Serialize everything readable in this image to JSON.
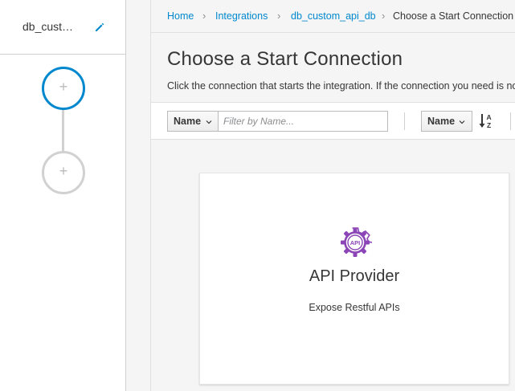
{
  "sidebar": {
    "integration_name": "db_custom_api_db",
    "icons": {
      "edit": "pencil-icon",
      "add_step": "plus-icon"
    },
    "steps": [
      {
        "state": "active",
        "glyph": "+"
      },
      {
        "state": "inactive",
        "glyph": "+"
      }
    ]
  },
  "breadcrumb": {
    "items": [
      "Home",
      "Integrations",
      "db_custom_api_db",
      "Choose a Start Connection"
    ],
    "separator": "›"
  },
  "page": {
    "title": "Choose a Start Connection",
    "description": "Click the connection that starts the integration. If the connection you need is not available, click Create Connection."
  },
  "toolbar": {
    "filter_type": "Name",
    "filter_placeholder": "Filter by Name...",
    "filter_value": "",
    "sort_field": "Name",
    "sort_direction_icon": "sort-alpha-ascending-icon"
  },
  "connections": [
    {
      "name": "API Provider",
      "description": "Expose Restful APIs",
      "icon": "api-gear-icon",
      "icon_text": "API"
    }
  ],
  "colors": {
    "link": "#0088ce",
    "accent_purple": "#8b45b6",
    "border": "#d1d1d1",
    "background": "#f5f5f5"
  }
}
